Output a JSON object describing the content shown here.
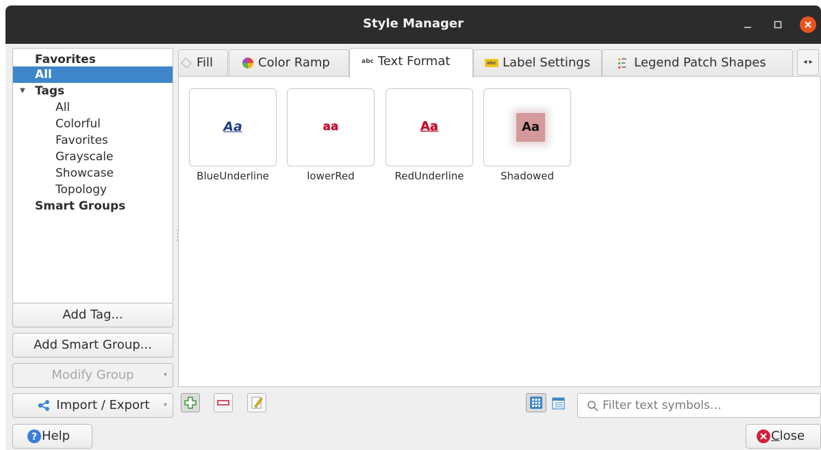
{
  "window": {
    "title": "Style Manager"
  },
  "tree": {
    "items": [
      {
        "label": "Favorites",
        "bold": true
      },
      {
        "label": "All",
        "bold": true,
        "selected": true
      },
      {
        "label": "Tags",
        "bold": true,
        "expanded": true
      },
      {
        "label": "All"
      },
      {
        "label": "Colorful"
      },
      {
        "label": "Favorites"
      },
      {
        "label": "Grayscale"
      },
      {
        "label": "Showcase"
      },
      {
        "label": "Topology"
      },
      {
        "label": "Smart Groups",
        "bold": true
      }
    ]
  },
  "side_buttons": {
    "add_tag": "Add Tag...",
    "add_smart_group": "Add Smart Group...",
    "modify_group": "Modify Group",
    "import_export": "Import / Export"
  },
  "tabs": [
    {
      "label": "Fill",
      "icon": "fill-icon"
    },
    {
      "label": "Color Ramp",
      "icon": "color-ramp-icon"
    },
    {
      "label": "Text Format",
      "icon": "text-format-icon",
      "active": true
    },
    {
      "label": "Label Settings",
      "icon": "label-settings-icon"
    },
    {
      "label": "Legend Patch Shapes",
      "icon": "legend-patch-icon"
    }
  ],
  "tab_icon_text": {
    "text_format": "abc",
    "label_settings": "abc"
  },
  "symbols": [
    {
      "name": "BlueUnderline",
      "preview": "Aa",
      "color": "#1f3c8c"
    },
    {
      "name": "lowerRed",
      "preview": "aa",
      "color": "#c8102e"
    },
    {
      "name": "RedUnderline",
      "preview": "Aa",
      "color": "#c8102e"
    },
    {
      "name": "Shadowed",
      "preview": "Aa",
      "color": "#111111",
      "bg": "#d49a9a"
    }
  ],
  "filter": {
    "placeholder": "Filter text symbols…",
    "value": ""
  },
  "footer": {
    "help": "Help",
    "close_prefix": "",
    "close_mnemonic": "C",
    "close_rest": "lose"
  },
  "colors": {
    "selection": "#3e86c9",
    "close_accent": "#e95420",
    "help_blue": "#3b7dd8"
  }
}
